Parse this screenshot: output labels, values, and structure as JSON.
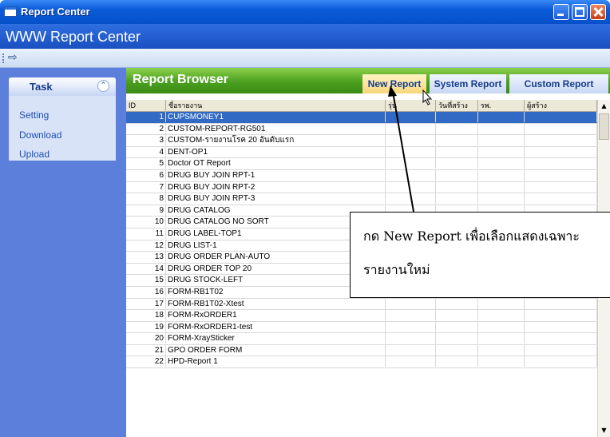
{
  "window": {
    "title": "Report Center"
  },
  "app": {
    "title": "WWW Report Center"
  },
  "toolbar": {
    "icon": "forward-arrow-icon"
  },
  "task_panel": {
    "title": "Task",
    "items": [
      {
        "label": "Setting"
      },
      {
        "label": "Download"
      },
      {
        "label": "Upload"
      }
    ]
  },
  "browser": {
    "title": "Report Browser",
    "tabs": [
      {
        "label": "New Report"
      },
      {
        "label": "System Report"
      },
      {
        "label": "Custom Report"
      }
    ]
  },
  "grid": {
    "headers": [
      "ID",
      "ชื่อรายงาน",
      "รุ่น",
      "วันที่สร้าง",
      "รพ.",
      "ผู้สร้าง"
    ],
    "selected_id": "1",
    "rows": [
      {
        "id": "1",
        "name": "CUPSMONEY1"
      },
      {
        "id": "2",
        "name": "CUSTOM-REPORT-RG501"
      },
      {
        "id": "3",
        "name": "CUSTOM-รายงานโรค 20 อันดับแรก"
      },
      {
        "id": "4",
        "name": "DENT-OP1"
      },
      {
        "id": "5",
        "name": "Doctor OT Report"
      },
      {
        "id": "6",
        "name": "DRUG BUY JOIN RPT-1"
      },
      {
        "id": "7",
        "name": "DRUG BUY JOIN RPT-2"
      },
      {
        "id": "8",
        "name": "DRUG BUY JOIN RPT-3"
      },
      {
        "id": "9",
        "name": "DRUG CATALOG"
      },
      {
        "id": "10",
        "name": "DRUG CATALOG NO SORT"
      },
      {
        "id": "11",
        "name": "DRUG LABEL-TOP1"
      },
      {
        "id": "12",
        "name": "DRUG LIST-1"
      },
      {
        "id": "13",
        "name": "DRUG ORDER PLAN-AUTO"
      },
      {
        "id": "14",
        "name": "DRUG ORDER TOP 20"
      },
      {
        "id": "15",
        "name": "DRUG STOCK-LEFT"
      },
      {
        "id": "16",
        "name": "FORM-RB1T02"
      },
      {
        "id": "17",
        "name": "FORM-RB1T02-Xtest"
      },
      {
        "id": "18",
        "name": "FORM-RxORDER1"
      },
      {
        "id": "19",
        "name": "FORM-RxORDER1-test"
      },
      {
        "id": "20",
        "name": "FORM-XraySticker"
      },
      {
        "id": "21",
        "name": "GPO ORDER FORM"
      },
      {
        "id": "22",
        "name": "HPD-Report 1"
      }
    ]
  },
  "callout": {
    "line1": "กด New Report เพื่อเลือกแสดงเฉพาะ",
    "line2": "รายงานใหม่"
  },
  "colors": {
    "title_bar": "#0a5bd8",
    "task_pane": "#5c7fdc",
    "browser_header": "#4aa020",
    "selection": "#316ac5"
  }
}
